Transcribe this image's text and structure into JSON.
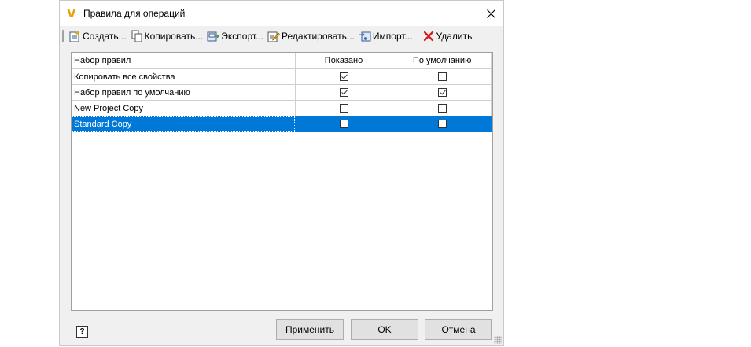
{
  "window": {
    "title": "Правила для операций"
  },
  "toolbar": {
    "create": "Создать...",
    "copy": "Копировать...",
    "export": "Экспорт...",
    "edit": "Редактировать...",
    "import": "Импорт...",
    "delete": "Удалить"
  },
  "grid": {
    "columns": {
      "name": "Набор правил",
      "shown": "Показано",
      "default": "По умолчанию"
    },
    "rows": [
      {
        "name": "Копировать все свойства",
        "shown": true,
        "default": false
      },
      {
        "name": "Набор правил по умолчанию",
        "shown": true,
        "default": true
      },
      {
        "name": "New Project Copy",
        "shown": false,
        "default": false
      },
      {
        "name": "Standard Copy",
        "shown": false,
        "default": false,
        "selected": true
      }
    ]
  },
  "footer": {
    "help": "?",
    "apply": "Применить",
    "ok": "OK",
    "cancel": "Отмена"
  },
  "colors": {
    "selection": "#0078d7",
    "accent_icon": "#e8a100"
  }
}
